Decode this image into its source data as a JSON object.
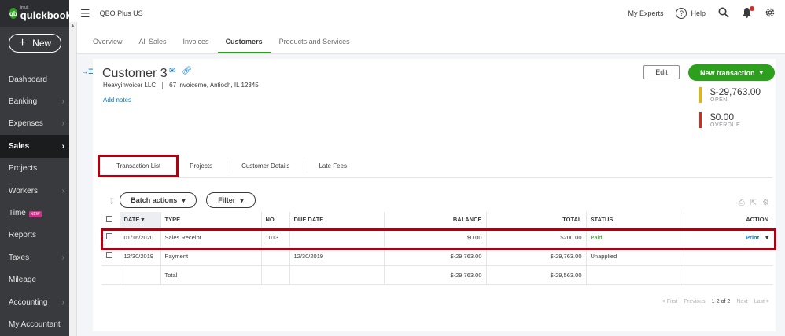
{
  "sidebar": {
    "logo_small": "intuit",
    "logo_main": "quickbooks",
    "new_label": "New",
    "items": [
      {
        "label": "Dashboard",
        "chevron": false
      },
      {
        "label": "Banking",
        "chevron": true
      },
      {
        "label": "Expenses",
        "chevron": true
      },
      {
        "label": "Sales",
        "chevron": true,
        "active": true
      },
      {
        "label": "Projects",
        "chevron": false
      },
      {
        "label": "Workers",
        "chevron": true
      },
      {
        "label": "Time",
        "chevron": false,
        "tag": "NEW"
      },
      {
        "label": "Reports",
        "chevron": false
      },
      {
        "label": "Taxes",
        "chevron": true
      },
      {
        "label": "Mileage",
        "chevron": false
      },
      {
        "label": "Accounting",
        "chevron": true
      },
      {
        "label": "My Accountant",
        "chevron": false
      }
    ]
  },
  "topbar": {
    "company": "QBO Plus US",
    "my_experts": "My Experts",
    "help": "Help"
  },
  "tabs": [
    "Overview",
    "All Sales",
    "Invoices",
    "Customers",
    "Products and Services"
  ],
  "active_tab": "Customers",
  "customer": {
    "name": "Customer 3",
    "company": "Heavyinvoicer LLC",
    "address": "67 Invoiceme, Antioch, IL 12345",
    "add_notes": "Add notes"
  },
  "buttons": {
    "edit": "Edit",
    "new_transaction": "New transaction",
    "batch_actions": "Batch actions",
    "filter": "Filter"
  },
  "summary": {
    "open_amount": "$-29,763.00",
    "open_label": "OPEN",
    "overdue_amount": "$0.00",
    "overdue_label": "OVERDUE"
  },
  "subtabs": [
    "Transaction List",
    "Projects",
    "Customer Details",
    "Late Fees"
  ],
  "table": {
    "headers": {
      "date": "DATE ▾",
      "type": "TYPE",
      "no": "NO.",
      "due": "DUE DATE",
      "balance": "BALANCE",
      "total": "TOTAL",
      "status": "STATUS",
      "action": "ACTION"
    },
    "rows": [
      {
        "date": "01/16/2020",
        "type": "Sales Receipt",
        "no": "1013",
        "due": "",
        "balance": "$0.00",
        "total": "$200.00",
        "status": "Paid",
        "action": "Print"
      },
      {
        "date": "12/30/2019",
        "type": "Payment",
        "no": "",
        "due": "12/30/2019",
        "balance": "$-29,763.00",
        "total": "$-29,763.00",
        "status": "Unapplied",
        "action": ""
      }
    ],
    "total_row": {
      "label": "Total",
      "balance": "$-29,763.00",
      "total": "$-29,563.00"
    }
  },
  "pager": {
    "first": "< First",
    "previous": "Previous",
    "range": "1-2 of 2",
    "next": "Next",
    "last": "Last >"
  },
  "colors": {
    "brand_green": "#2ca01c",
    "sidebar_bg": "#393a3d",
    "link_blue": "#0077c5",
    "open_bar": "#f0b000",
    "overdue_bar": "#d52b1e",
    "highlight_red": "#b0000f"
  }
}
